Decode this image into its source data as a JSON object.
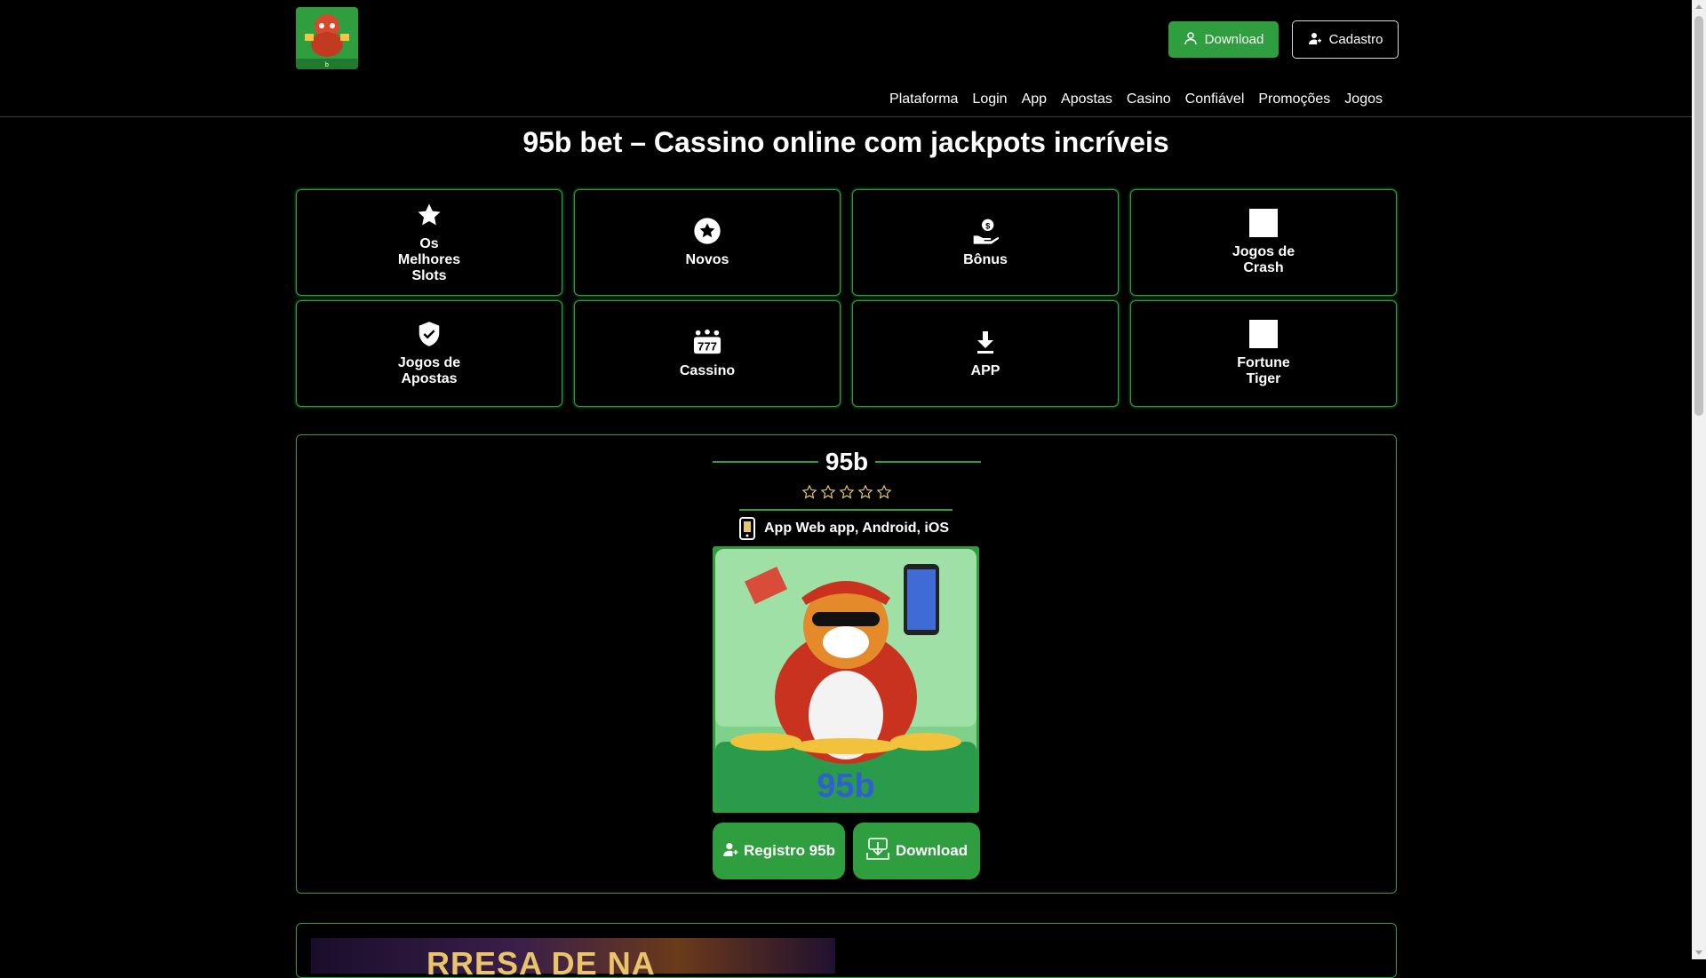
{
  "header": {
    "download_label": "Download",
    "cadastro_label": "Cadastro",
    "logo_text": "b",
    "nav": [
      "Plataforma",
      "Login",
      "App",
      "Apostas",
      "Casino",
      "Confiável",
      "Promoções",
      "Jogos"
    ]
  },
  "page_title": "95b bet – Cassino online com jackpots incríveis",
  "categories": [
    {
      "label": "Os Melhores Slots",
      "icon": "star-icon"
    },
    {
      "label": "Novos",
      "icon": "star-circle-icon"
    },
    {
      "label": "Bônus",
      "icon": "money-hand-icon"
    },
    {
      "label": "Jogos de Crash",
      "icon": "blank-icon"
    },
    {
      "label": "Jogos de Apostas",
      "icon": "shield-check-icon"
    },
    {
      "label": "Cassino",
      "icon": "slot-777-icon"
    },
    {
      "label": "APP",
      "icon": "download-icon"
    },
    {
      "label": "Fortune Tiger",
      "icon": "blank-icon"
    }
  ],
  "app_card": {
    "brand": "95b",
    "rating_stars": 5,
    "platforms": "App Web app, Android, iOS",
    "banner_text": "95b",
    "register_label": "Registro 95b",
    "download_label": "Download"
  },
  "promo": {
    "banner_text": "RRESA DE NA"
  },
  "colors": {
    "accent": "#2e9e3f",
    "background": "#000000",
    "star": "#e9c46a"
  }
}
